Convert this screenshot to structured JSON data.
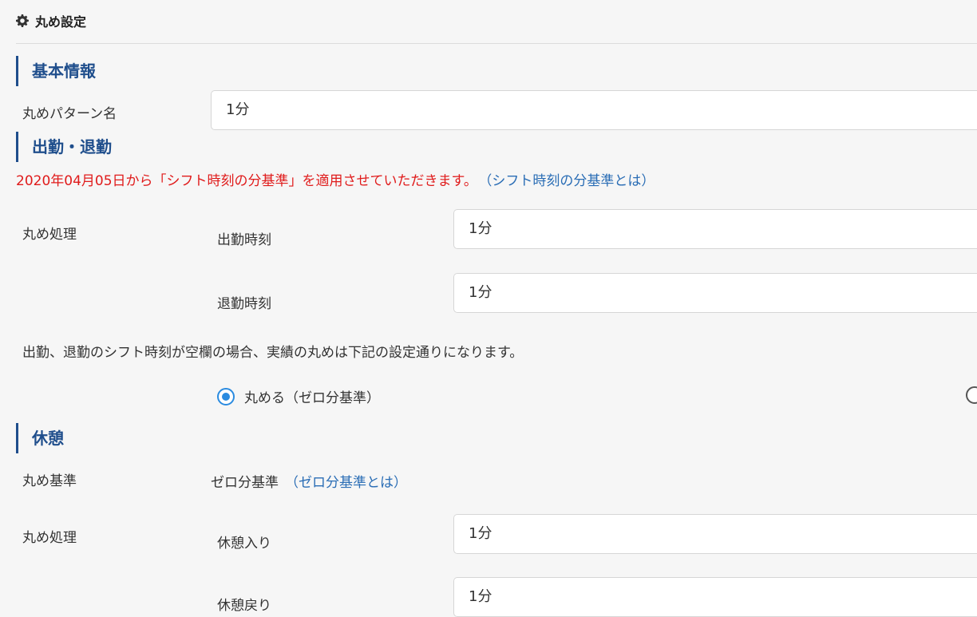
{
  "header": {
    "title": "丸め設定",
    "icon": "gear-icon"
  },
  "sections": {
    "basic": "基本情報",
    "clock": "出勤・退勤",
    "break": "休憩"
  },
  "basic": {
    "pattern_label": "丸めパターン名",
    "pattern_value": "1分"
  },
  "clock": {
    "notice": "2020年04月05日から「シフト時刻の分基準」を適用させていただきます。",
    "notice_link": "（シフト時刻の分基準とは）",
    "rounding_label": "丸め処理",
    "clock_in_label": "出勤時刻",
    "clock_in_value": "1分",
    "clock_out_label": "退勤時刻",
    "clock_out_value": "1分",
    "blank_note": "出勤、退勤のシフト時刻が空欄の場合、実績の丸めは下記の設定通りになります。",
    "radio_round_label": "丸める（ゼロ分基準）",
    "accent_color": "#2a8be0"
  },
  "break": {
    "basis_label": "丸め基準",
    "basis_value": "ゼロ分基準",
    "basis_link": "（ゼロ分基準とは）",
    "rounding_label": "丸め処理",
    "break_in_label": "休憩入り",
    "break_in_value": "1分",
    "break_out_label": "休憩戻り",
    "break_out_value": "1分"
  },
  "colors": {
    "section_title": "#1f4e8c",
    "notice": "#e01b1b",
    "link": "#2a6db5"
  }
}
